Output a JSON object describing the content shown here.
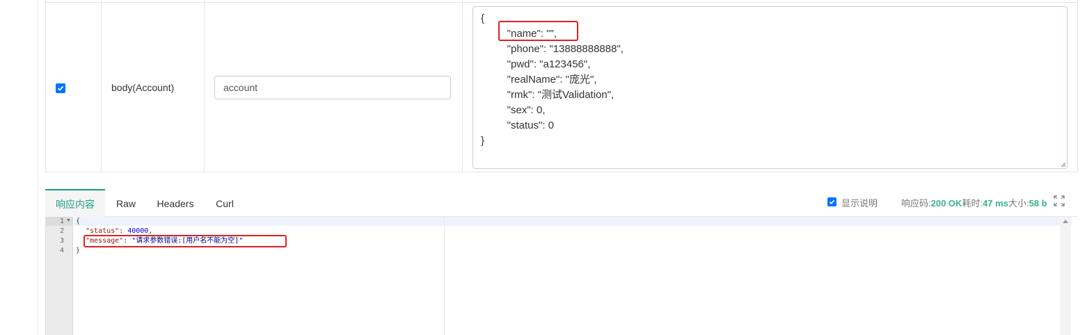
{
  "params_row": {
    "checked": true,
    "name": "body(Account)",
    "input_value": "account",
    "json_lines": [
      "{",
      "    \"name\": \"\",",
      "    \"phone\": \"13888888888\",",
      "    \"pwd\": \"a123456\",",
      "    \"realName\": \"庞光\",",
      "    \"rmk\": \"测试Validation\",",
      "    \"sex\": 0,",
      "    \"status\": 0",
      "}"
    ]
  },
  "tabs": [
    {
      "label": "响应内容",
      "active": true
    },
    {
      "label": "Raw",
      "active": false
    },
    {
      "label": "Headers",
      "active": false
    },
    {
      "label": "Curl",
      "active": false
    }
  ],
  "status_bar": {
    "show_desc_label": "显示说明",
    "code_label": "响应码:",
    "code_value": "200 OK",
    "time_label": "耗时:",
    "time_value": "47 ms",
    "size_label": "大小:",
    "size_value": "58 b"
  },
  "response": {
    "line_numbers": [
      "1",
      "2",
      "3",
      "4"
    ],
    "open_brace": "{",
    "status_key": "\"status\"",
    "status_value": "40000",
    "message_key": "\"message\"",
    "message_value": "\"请求参数错误:[用户名不能为空]\"",
    "close_brace": "}"
  },
  "colors": {
    "accent": "#1a9e86",
    "highlight": "#e02020",
    "checkbox": "#0075ff"
  }
}
